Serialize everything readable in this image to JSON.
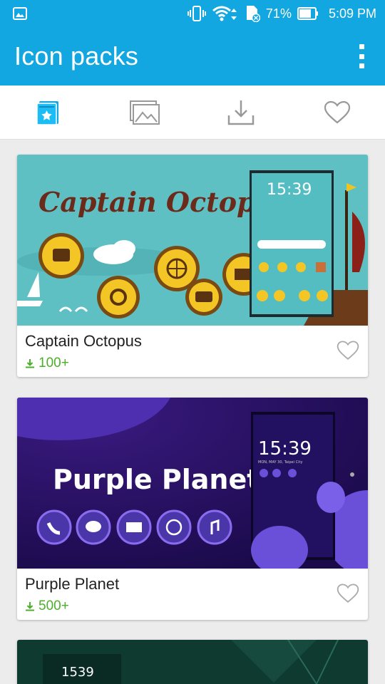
{
  "status_bar": {
    "battery": "71%",
    "time": "5:09 PM"
  },
  "app_bar": {
    "title": "Icon packs"
  },
  "tabs": [
    {
      "name": "my-themes",
      "icon": "book-star-icon"
    },
    {
      "name": "wallpapers",
      "icon": "images-icon"
    },
    {
      "name": "downloads",
      "icon": "download-icon"
    },
    {
      "name": "favorites",
      "icon": "heart-icon"
    }
  ],
  "packs": [
    {
      "name": "Captain Octopus",
      "downloads": "100+",
      "banner_title": "Captain Octopus",
      "preview_time": "15:39"
    },
    {
      "name": "Purple Planet",
      "downloads": "500+",
      "banner_title": "Purple Planet",
      "preview_time": "15:39",
      "preview_date": "MON, MAY 30, Taipei City"
    },
    {
      "preview_time": "1539"
    }
  ],
  "colors": {
    "accent": "#12a7e0",
    "download_green": "#4caf2a"
  }
}
